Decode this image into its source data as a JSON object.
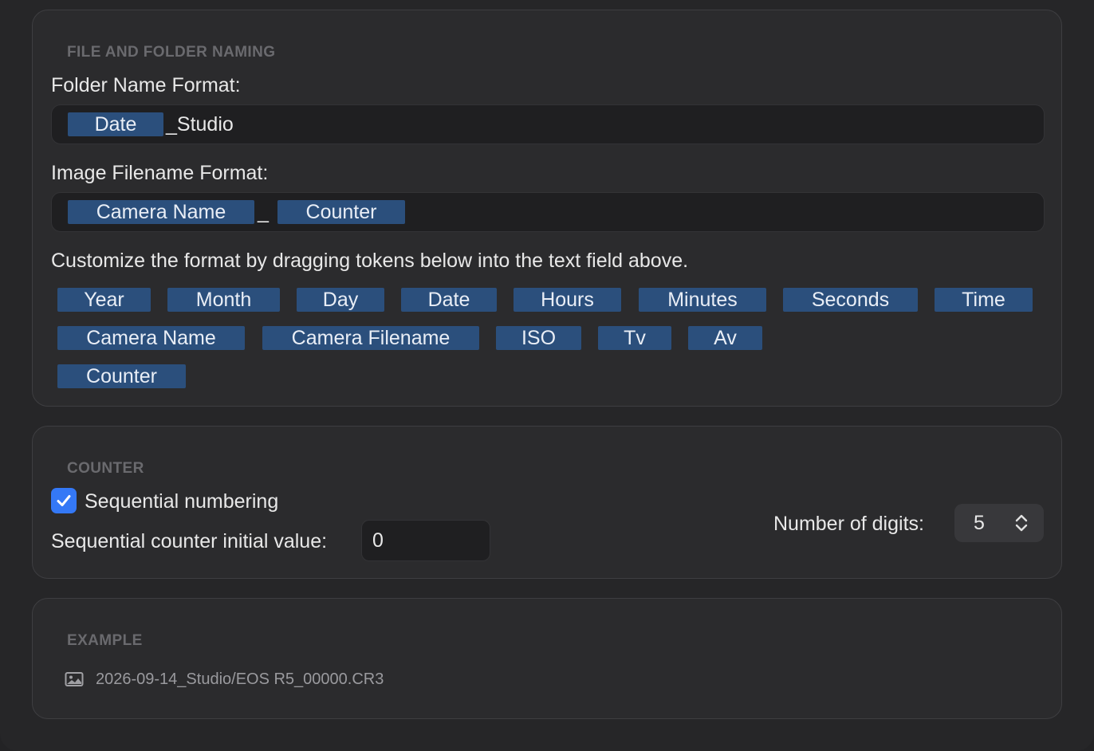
{
  "naming": {
    "section_title": "FILE AND FOLDER NAMING",
    "folder_label": "Folder Name Format:",
    "folder_tokens": [
      "Date"
    ],
    "folder_suffix": "_Studio",
    "image_label": "Image Filename Format:",
    "image_tokens": [
      "Camera Name",
      "Counter"
    ],
    "image_separator": "_",
    "hint": "Customize the format by dragging tokens below into the text field above.",
    "tokens": [
      "Year",
      "Month",
      "Day",
      "Date",
      "Hours",
      "Minutes",
      "Seconds",
      "Time",
      "Camera Name",
      "Camera Filename",
      "ISO",
      "Tv",
      "Av",
      "Counter"
    ]
  },
  "counter": {
    "section_title": "COUNTER",
    "sequential_label": "Sequential numbering",
    "sequential_checked": true,
    "initial_label": "Sequential counter initial value:",
    "initial_value": "0",
    "digits_label": "Number of digits:",
    "digits_value": "5"
  },
  "example": {
    "section_title": "EXAMPLE",
    "path": "2026-09-14_Studio/EOS R5_00000.CR3",
    "icon": "photo-icon"
  },
  "colors": {
    "token_bg": "#2b4f7c",
    "accent": "#3478f6"
  }
}
